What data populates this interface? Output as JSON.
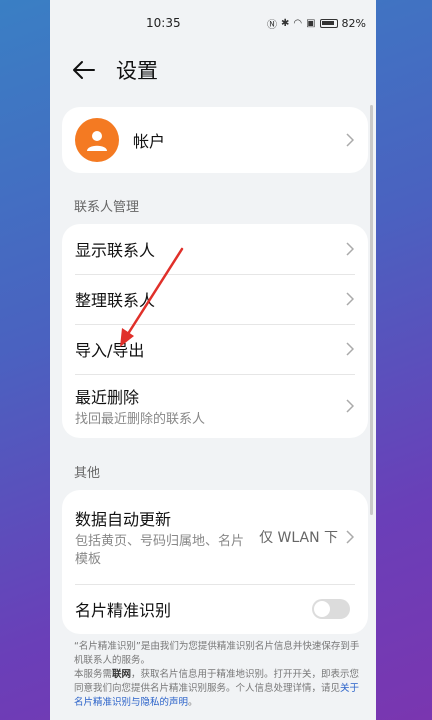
{
  "status": {
    "time": "10:35",
    "battery": "82%"
  },
  "header": {
    "title": "设置"
  },
  "account": {
    "label": "帐户"
  },
  "sections": {
    "contacts_title": "联系人管理",
    "other_title": "其他"
  },
  "contacts_items": [
    {
      "label": "显示联系人"
    },
    {
      "label": "整理联系人"
    },
    {
      "label": "导入/导出"
    },
    {
      "label": "最近删除",
      "sub": "找回最近删除的联系人"
    }
  ],
  "other_items": {
    "auto_update": {
      "label": "数据自动更新",
      "sub": "包括黄页、号码归属地、名片模板",
      "value": "仅 WLAN 下"
    },
    "card_recognition": {
      "label": "名片精准识别",
      "enabled": false
    }
  },
  "footnote": {
    "line1": "“名片精准识别”是由我们为您提供精准识别名片信息并快速保存到手机联系人的服务。",
    "line2a": "本服务需",
    "line2b": "联网",
    "line2c": "，获取名片信息用于精准地识别。打开开关，即表示您同意我们向您提供名片精准识别服务。个人信息处理详情，请见",
    "link": "关于名片精准识别与隐私的声明",
    "end": "。"
  },
  "colors": {
    "accent": "#f47a22",
    "link": "#2a62c9",
    "annotation_arrow": "#e0302a"
  }
}
